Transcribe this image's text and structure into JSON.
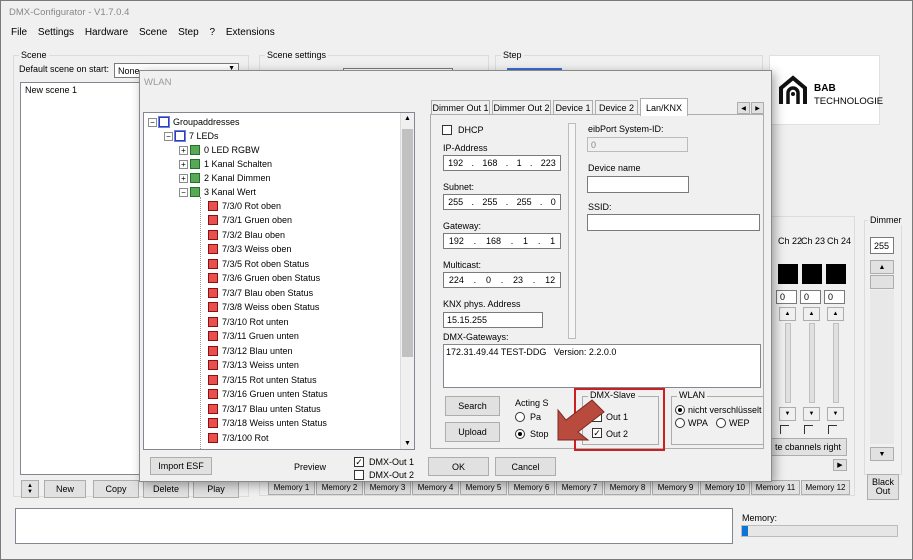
{
  "app": {
    "title": "DMX-Configurator - V1.7.0.4",
    "menu": [
      "File",
      "Settings",
      "Hardware",
      "Scene",
      "Step",
      "?",
      "Extensions"
    ]
  },
  "scene": {
    "group_title": "Scene",
    "default_label": "Default scene on start:",
    "default_value": "None",
    "items": [
      "New scene 1"
    ],
    "buttons": {
      "new": "New",
      "copy": "Copy",
      "delete": "Delete",
      "play": "Play"
    }
  },
  "scene_settings": {
    "group_title": "Scene settings"
  },
  "step": {
    "group_title": "Step"
  },
  "logo": {
    "line1": "BAB",
    "line2": "TECHNOLOGIE"
  },
  "channels": {
    "headers": [
      "Ch 22",
      "Ch 23",
      "Ch 24"
    ],
    "values": [
      "0",
      "0",
      "0"
    ],
    "dimmer_title": "Dimmer",
    "dimmer_value": "255",
    "channels_right": "te cbannels right",
    "black_out": "Black Out"
  },
  "memory": {
    "label": "Memory:",
    "buttons": [
      "Memory 1",
      "Memory 2",
      "Memory 3",
      "Memory 4",
      "Memory 5",
      "Memory 6",
      "Memory 7",
      "Memory 8",
      "Memory 9",
      "Memory 10",
      "Memory 11",
      "Memory 12"
    ]
  },
  "dialog": {
    "title": "WLAN",
    "tree": {
      "root": "Groupaddresses",
      "level1": "7 LEDs",
      "level2": [
        "0 LED RGBW",
        "1 Kanal Schalten",
        "2 Kanal Dimmen",
        "3 Kanal Wert"
      ],
      "leaves": [
        "7/3/0 Rot oben",
        "7/3/1 Gruen oben",
        "7/3/2 Blau oben",
        "7/3/3 Weiss oben",
        "7/3/5 Rot oben Status",
        "7/3/6 Gruen oben Status",
        "7/3/7 Blau oben Status",
        "7/3/8 Weiss oben Status",
        "7/3/10 Rot unten",
        "7/3/11 Gruen unten",
        "7/3/12 Blau unten",
        "7/3/13 Weiss unten",
        "7/3/15 Rot unten Status",
        "7/3/16 Gruen unten Status",
        "7/3/17 Blau unten Status",
        "7/3/18 Weiss unten Status",
        "7/3/100 Rot"
      ]
    },
    "tabs": [
      "Dimmer Out 1",
      "Dimmer Out 2",
      "Device 1",
      "Device 2",
      "Lan/KNX"
    ],
    "dhcp_label": "DHCP",
    "ip_label": "IP-Address",
    "ip": [
      "192",
      "168",
      "1",
      "223"
    ],
    "subnet_label": "Subnet:",
    "subnet": [
      "255",
      "255",
      "255",
      "0"
    ],
    "gateway_label": "Gateway:",
    "gateway": [
      "192",
      "168",
      "1",
      "1"
    ],
    "multicast_label": "Multicast:",
    "multicast": [
      "224",
      "0",
      "23",
      "12"
    ],
    "knx_label": "KNX phys. Address",
    "knx_value": "15.15.255",
    "eibport_label": "eibPort System-ID:",
    "eibport_value": "0",
    "device_name_label": "Device name",
    "ssid_label": "SSID:",
    "gateways_label": "DMX-Gateways:",
    "gateways_text": "172.31.49.44 TEST-DDG   Version: 2.2.0.0",
    "search_btn": "Search",
    "upload_btn": "Upload",
    "acting_label": "Acting S",
    "acting_options": [
      "Pa",
      "Stop"
    ],
    "slave_title": "DMX-Slave",
    "slave_options": [
      "Out 1",
      "Out 2"
    ],
    "wlan_title": "WLAN",
    "wlan_options": [
      "nicht verschlüsselt",
      "WPA",
      "WEP"
    ],
    "import_btn": "Import ESF",
    "preview_label": "Preview",
    "preview_options": [
      "DMX-Out 1",
      "DMX-Out 2"
    ],
    "ok_btn": "OK",
    "cancel_btn": "Cancel"
  },
  "colors": {
    "highlight": "#cc1f1f",
    "arrow": "#b84b3d"
  }
}
